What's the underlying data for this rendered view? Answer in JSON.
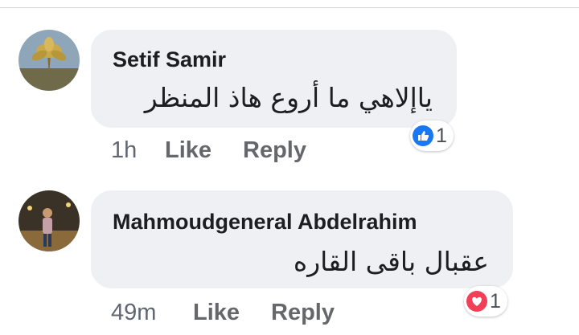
{
  "colors": {
    "like_blue": "#1877f2",
    "love_red": "#f33e58",
    "bubble_bg": "#eef0f3"
  },
  "comments": [
    {
      "author": "Setif Samir",
      "text": "ياإلاهي ما أروع هاذ المنظر",
      "time": "1h",
      "like_label": "Like",
      "reply_label": "Reply",
      "reaction_icon": "like-icon",
      "reaction_count": "1"
    },
    {
      "author": "Mahmoudgeneral Abdelrahim",
      "text": "عقبال باقى القاره",
      "time": "49m",
      "like_label": "Like",
      "reply_label": "Reply",
      "reaction_icon": "love-icon",
      "reaction_count": "1"
    }
  ]
}
